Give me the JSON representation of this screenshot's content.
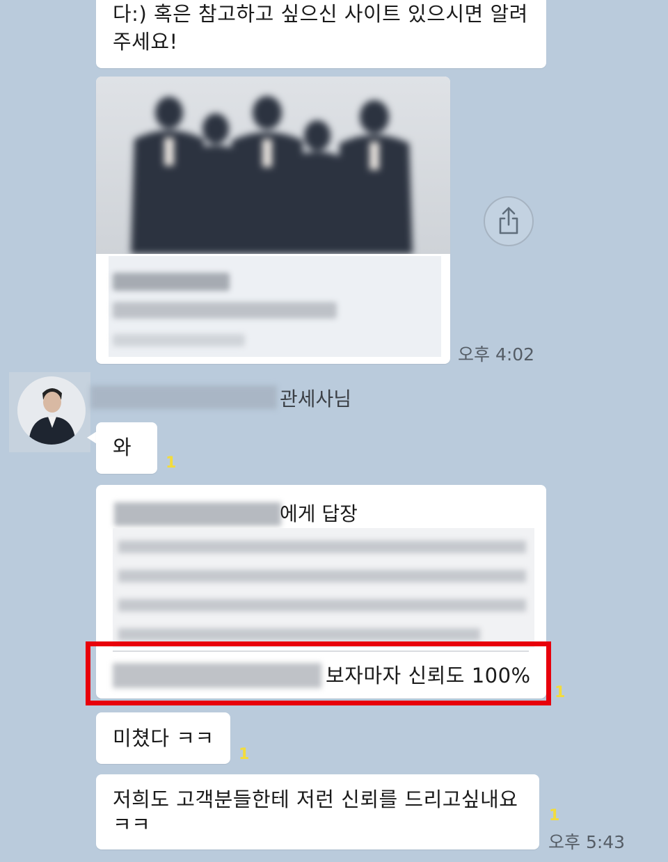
{
  "messages": {
    "m1_text": "다:)  혹은 참고하고 싶으신 사이트 있으시면 알려주세요!",
    "link_card": {
      "time": "오후 4:02"
    },
    "sender": {
      "name_suffix": "관세사님"
    },
    "m2": {
      "text": "와",
      "unread": "1"
    },
    "reply": {
      "header_suffix": "에게 답장",
      "text_suffix": "보자마자 신뢰도 100%",
      "unread": "1"
    },
    "m3": {
      "text": "미쳤다 ㅋㅋ",
      "unread": "1"
    },
    "m4": {
      "text": "저희도 고객분들한테 저런 신뢰를 드리고싶내요 ㅋㅋ",
      "unread": "1",
      "time": "오후 5:43"
    }
  },
  "icons": {
    "share": "share-icon"
  },
  "colors": {
    "background": "#bacbdc",
    "bubble": "#ffffff",
    "unread": "#f3dc3c",
    "highlight": "#e8000b"
  }
}
